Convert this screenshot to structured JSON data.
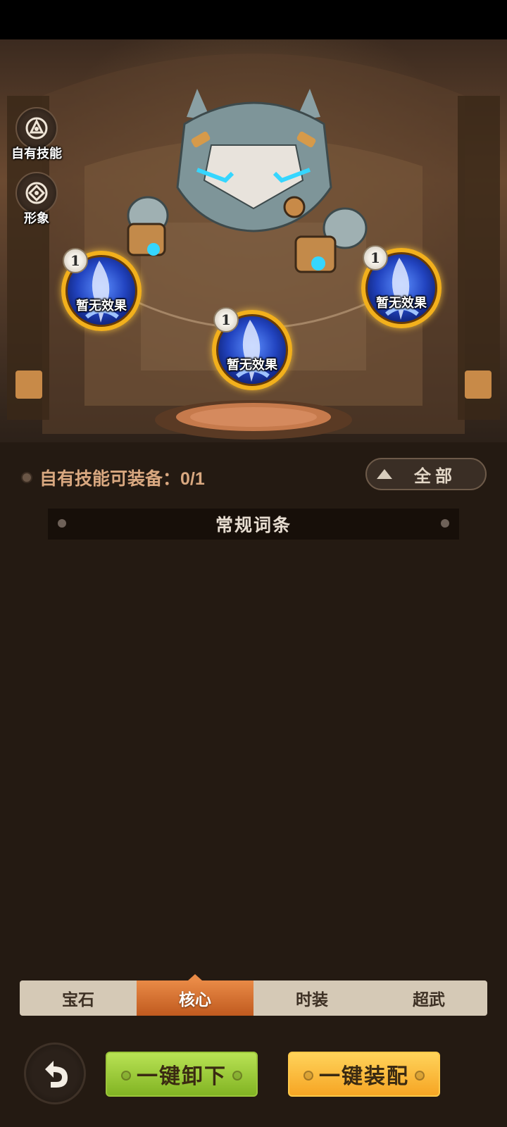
{
  "sidebar": {
    "skills_label": "自有技能",
    "appearance_label": "形象"
  },
  "slots": [
    {
      "level": "1",
      "effect": "暂无效果"
    },
    {
      "level": "1",
      "effect": "暂无效果"
    },
    {
      "level": "1",
      "effect": "暂无效果"
    }
  ],
  "equip_status": "自有技能可装备：0/1",
  "filter": {
    "label": "全部"
  },
  "section_header": "常规词条",
  "tabs": [
    "宝石",
    "核心",
    "时装",
    "超武"
  ],
  "active_tab": "核心",
  "actions": {
    "unequip_all": "一键卸下",
    "equip_all": "一键装配"
  },
  "colors": {
    "accent_orange": "#d16a2a",
    "gold_ring": "#f2b01c",
    "green_button": "#9fd23c",
    "yellow_button": "#f9b934"
  }
}
